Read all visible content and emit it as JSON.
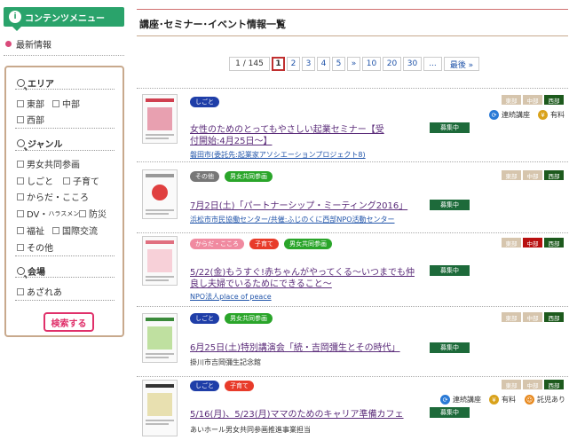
{
  "sidebar": {
    "menu_title": "コンテンツメニュー",
    "latest": "最新情報",
    "search_button": "検索する",
    "area": {
      "title": "エリア",
      "options": [
        "東部",
        "中部",
        "西部"
      ]
    },
    "genre": {
      "title": "ジャンル",
      "options": [
        "男女共同参画",
        "しごと",
        "子育て",
        "からだ・こころ",
        "DV・",
        "ハラスメント",
        "防災",
        "福祉",
        "国際交流",
        "その他"
      ]
    },
    "venue": {
      "title": "会場",
      "options": [
        "あざれあ"
      ]
    }
  },
  "main": {
    "title": "講座･セミナー･イベント情報一覧",
    "pager": {
      "count": "1 / 145",
      "pages": [
        "1",
        "2",
        "3",
        "4",
        "5",
        "»",
        "10",
        "20",
        "30",
        "...",
        "最後 »"
      ]
    },
    "regions": [
      "東部",
      "中部",
      "西部"
    ],
    "items": [
      {
        "tags": [
          "しごと"
        ],
        "title": "女性のためのとってもやさしい起業セミナー【受付開始:4月25日～】",
        "org": "磐田市(委託先:起業家アソシエーションプロジェクト8)",
        "status": "募集中",
        "meta": [
          "連続講座",
          "有料"
        ]
      },
      {
        "tags": [
          "その他",
          "男女共同参画"
        ],
        "title": "7月2日(土)「パートナーシップ・ミーティング2016」",
        "org": "浜松市市民協働センター/共催:ふじのくに西部NPO活動センター",
        "status": "募集中",
        "meta": []
      },
      {
        "tags": [
          "からだ・こころ",
          "子育て",
          "男女共同参画"
        ],
        "title": "5/22(金)もうすぐ!赤ちゃんがやってくる～いつまでも仲良し夫婦でいるためにできること～",
        "org": "NPO法人place of peace",
        "status": "募集中",
        "meta": []
      },
      {
        "tags": [
          "しごと",
          "男女共同参画"
        ],
        "title": "6月25日(土)特別講演会「続・吉岡彌生とその時代」",
        "org": "掛川市吉岡彌生記念館",
        "status": "募集中",
        "meta": []
      },
      {
        "tags": [
          "しごと",
          "子育て"
        ],
        "title": "5/16(月)、5/23(月)ママのためのキャリア準備カフェ",
        "org": "あいホール男女共同参画推進事業担当",
        "status": "募集中",
        "meta": [
          "連続講座",
          "有料",
          "託児あり"
        ]
      }
    ]
  },
  "colors": {
    "accent_green": "#2aa36b",
    "status_green": "#1d6a3a",
    "link_purple": "#5b2c7a",
    "search_pink": "#e0306a"
  }
}
